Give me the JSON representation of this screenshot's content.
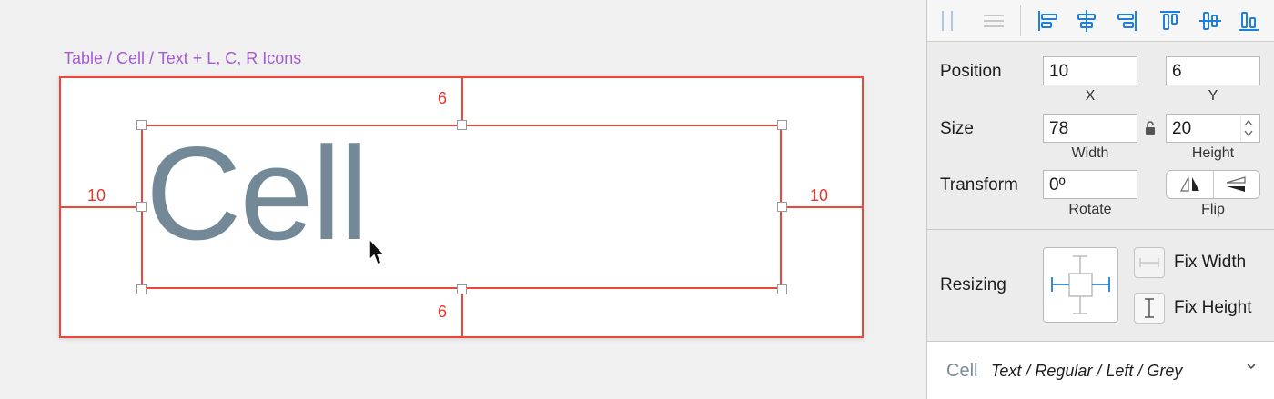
{
  "artboard": {
    "title": "Table / Cell / Text + L, C, R Icons",
    "text_content": "Cell"
  },
  "guides": {
    "top": "6",
    "bottom": "6",
    "left": "10",
    "right": "10"
  },
  "toolbar": {
    "tools": [
      "distribute-horizontal-icon",
      "distribute-vertical-icon",
      "align-left-icon",
      "align-horizontal-center-icon",
      "align-right-icon",
      "align-top-icon",
      "align-vertical-center-icon",
      "align-bottom-icon"
    ]
  },
  "inspector": {
    "position_label": "Position",
    "x_value": "10",
    "x_caption": "X",
    "y_value": "6",
    "y_caption": "Y",
    "size_label": "Size",
    "width_value": "78",
    "width_caption": "Width",
    "height_value": "20",
    "height_caption": "Height",
    "transform_label": "Transform",
    "rotate_value": "0º",
    "rotate_caption": "Rotate",
    "flip_caption": "Flip",
    "resizing_label": "Resizing",
    "fix_width_label": "Fix Width",
    "fix_height_label": "Fix Height"
  },
  "text_style": {
    "preview": "Cell",
    "name": "Text / Regular / Left / Grey"
  },
  "colors": {
    "accent_red": "#f0453a",
    "title_purple": "#a55bd1",
    "text_grey": "#748997",
    "blue_icon": "#1f7fd9"
  }
}
